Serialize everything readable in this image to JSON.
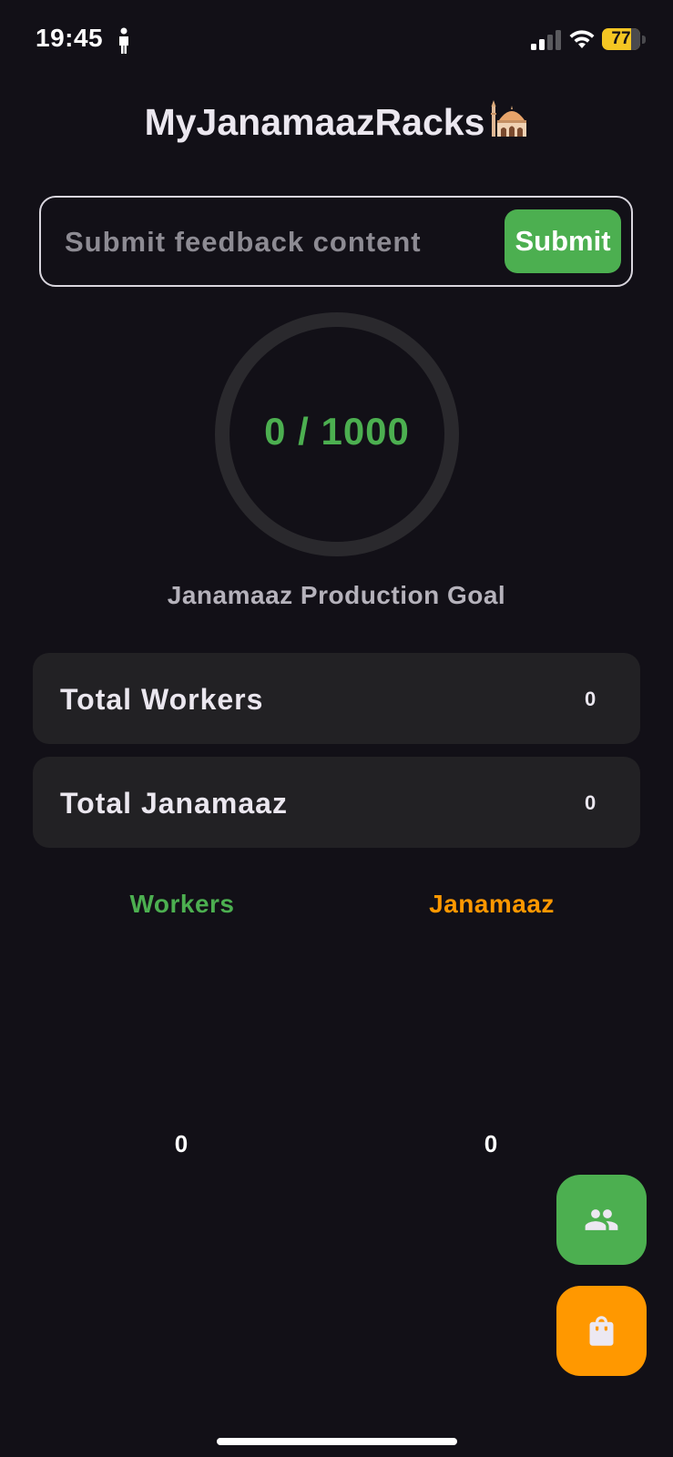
{
  "status_bar": {
    "time": "19:45",
    "battery_level": "77",
    "battery_fraction": 0.77
  },
  "header": {
    "title": "MyJanamaazRacks",
    "title_icon": "mosque-icon"
  },
  "feedback": {
    "placeholder": "Submit feedback content",
    "value": "",
    "submit_label": "Submit"
  },
  "goal": {
    "current": 0,
    "target": 1000,
    "display": "0 / 1000",
    "label": "Janamaaz Production Goal"
  },
  "stats": {
    "workers": {
      "label": "Total Workers",
      "value": "0"
    },
    "janamaaz": {
      "label": "Total Janamaaz",
      "value": "0"
    }
  },
  "chart_data": {
    "type": "bar",
    "categories": [
      "Workers",
      "Janamaaz"
    ],
    "values": [
      0,
      0
    ],
    "colors": [
      "#4caf50",
      "#ff9800"
    ],
    "value_labels": [
      "0",
      "0"
    ]
  },
  "fabs": {
    "workers_icon": "people-icon",
    "janamaaz_icon": "shopping-bag-icon"
  },
  "colors": {
    "background": "#121017",
    "accent_green": "#4caf50",
    "accent_orange": "#ff9800",
    "card": "#222124",
    "ring_track": "#2a292d",
    "battery": "#f4c623"
  }
}
